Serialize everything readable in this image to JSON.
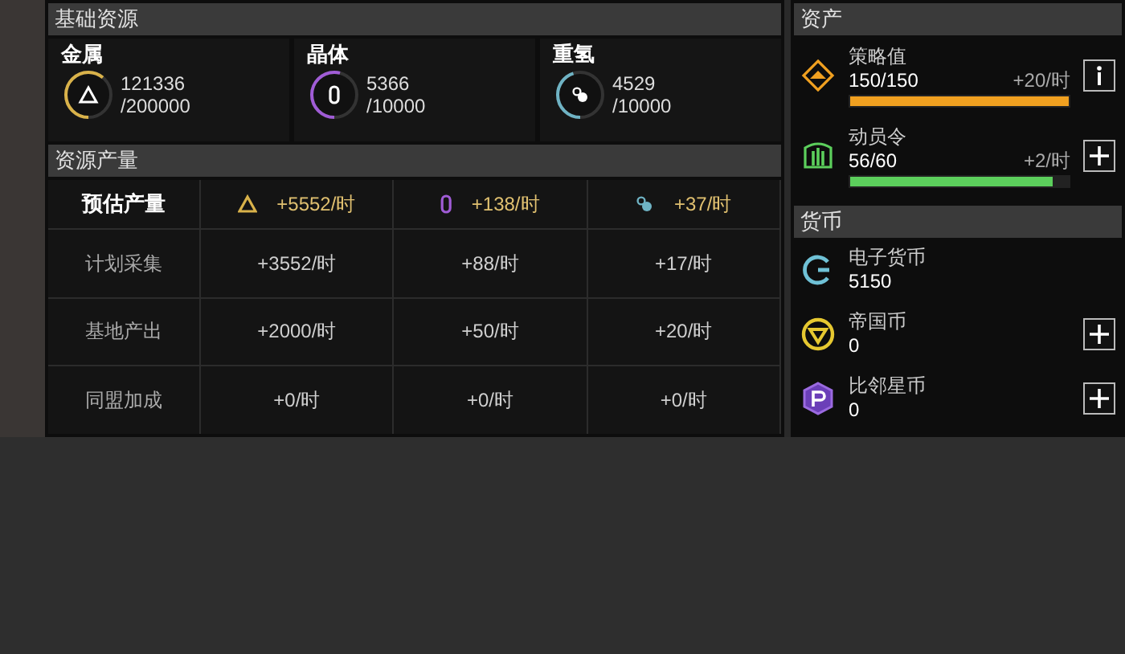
{
  "basic_resources": {
    "title": "基础资源",
    "items": [
      {
        "name": "金属",
        "amount": "121336",
        "capacity": "/200000",
        "level": 0.61,
        "color": "#d9b24a",
        "kind": "metal"
      },
      {
        "name": "晶体",
        "amount": "5366",
        "capacity": "/10000",
        "level": 0.54,
        "color": "#a05cd6",
        "kind": "crystal"
      },
      {
        "name": "重氢",
        "amount": "4529",
        "capacity": "/10000",
        "level": 0.45,
        "color": "#6fb3c4",
        "kind": "deuterium"
      }
    ]
  },
  "production": {
    "title": "资源产量",
    "header": {
      "label": "预估产量",
      "cells": [
        {
          "kind": "metal",
          "value": "+5552/时"
        },
        {
          "kind": "crystal",
          "value": "+138/时"
        },
        {
          "kind": "deuterium",
          "value": "+37/时"
        }
      ]
    },
    "rows": [
      {
        "label": "计划采集",
        "values": [
          "+3552/时",
          "+88/时",
          "+17/时"
        ]
      },
      {
        "label": "基地产出",
        "values": [
          "+2000/时",
          "+50/时",
          "+20/时"
        ]
      },
      {
        "label": "同盟加成",
        "values": [
          "+0/时",
          "+0/时",
          "+0/时"
        ]
      }
    ]
  },
  "assets": {
    "title": "资产",
    "items": [
      {
        "name": "策略值",
        "value": "150/150",
        "rate": "+20/时",
        "level": 1.0,
        "color": "#f0a020",
        "kind": "strategy"
      },
      {
        "name": "动员令",
        "value": "56/60",
        "rate": "+2/时",
        "level": 0.93,
        "color": "#5ccf5c",
        "kind": "mobilization"
      }
    ]
  },
  "currency": {
    "title": "货币",
    "items": [
      {
        "name": "电子货币",
        "value": "5150",
        "kind": "electronic",
        "add": false
      },
      {
        "name": "帝国币",
        "value": "0",
        "kind": "empire",
        "add": true
      },
      {
        "name": "比邻星币",
        "value": "0",
        "kind": "proxima",
        "add": true
      }
    ]
  }
}
